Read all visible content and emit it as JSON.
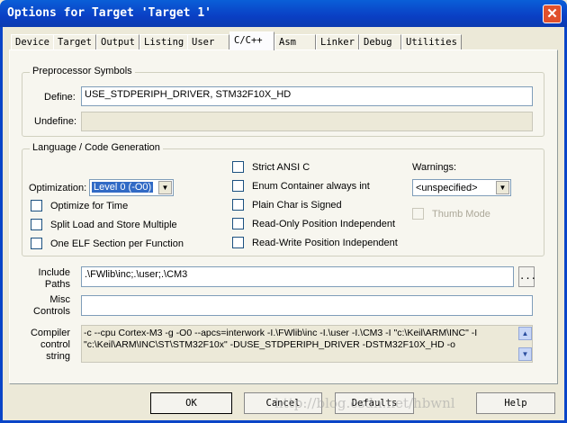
{
  "window": {
    "title": "Options for Target 'Target 1'",
    "close": "✕"
  },
  "tabs": [
    "Device",
    "Target",
    "Output",
    "Listing",
    "User",
    "C/C++",
    "Asm",
    "Linker",
    "Debug",
    "Utilities"
  ],
  "preprocessor": {
    "title": "Preprocessor Symbols",
    "define_label": "Define:",
    "define_value": "USE_STDPERIPH_DRIVER, STM32F10X_HD",
    "undefine_label": "Undefine:",
    "undefine_value": ""
  },
  "language": {
    "title": "Language / Code Generation",
    "optimization_label": "Optimization:",
    "optimization_value": "Level 0 (-O0)",
    "left_checks": [
      {
        "label": "Optimize for Time",
        "checked": false
      },
      {
        "label": "Split Load and Store Multiple",
        "checked": false
      },
      {
        "label": "One ELF Section per Function",
        "checked": false
      }
    ],
    "mid_checks": [
      {
        "label": "Strict ANSI C",
        "checked": false
      },
      {
        "label": "Enum Container always int",
        "checked": false
      },
      {
        "label": "Plain Char is Signed",
        "checked": false
      },
      {
        "label": "Read-Only Position Independent",
        "checked": false
      },
      {
        "label": "Read-Write Position Independent",
        "checked": false
      }
    ],
    "warnings_label": "Warnings:",
    "warnings_value": "<unspecified>",
    "thumb_mode": "Thumb Mode"
  },
  "include": {
    "label1": "Include",
    "label2": "Paths",
    "value": ".\\FWlib\\inc;.\\user;.\\CM3",
    "browse": "..."
  },
  "misc": {
    "label1": "Misc",
    "label2": "Controls",
    "value": ""
  },
  "compiler": {
    "label1": "Compiler",
    "label2": "control",
    "label3": "string",
    "line1": "-c --cpu Cortex-M3 -g -O0 --apcs=interwork -I.\\FWlib\\inc -I.\\user -I.\\CM3 -I \"c:\\Keil\\ARM\\INC\" -I",
    "line2": "\"c:\\Keil\\ARM\\INC\\ST\\STM32F10x\" -DUSE_STDPERIPH_DRIVER -DSTM32F10X_HD -o"
  },
  "buttons": {
    "ok": "OK",
    "cancel": "Cancel",
    "defaults": "Defaults",
    "help": "Help"
  },
  "watermark": "http://blog.csdn.net/hbwnl"
}
